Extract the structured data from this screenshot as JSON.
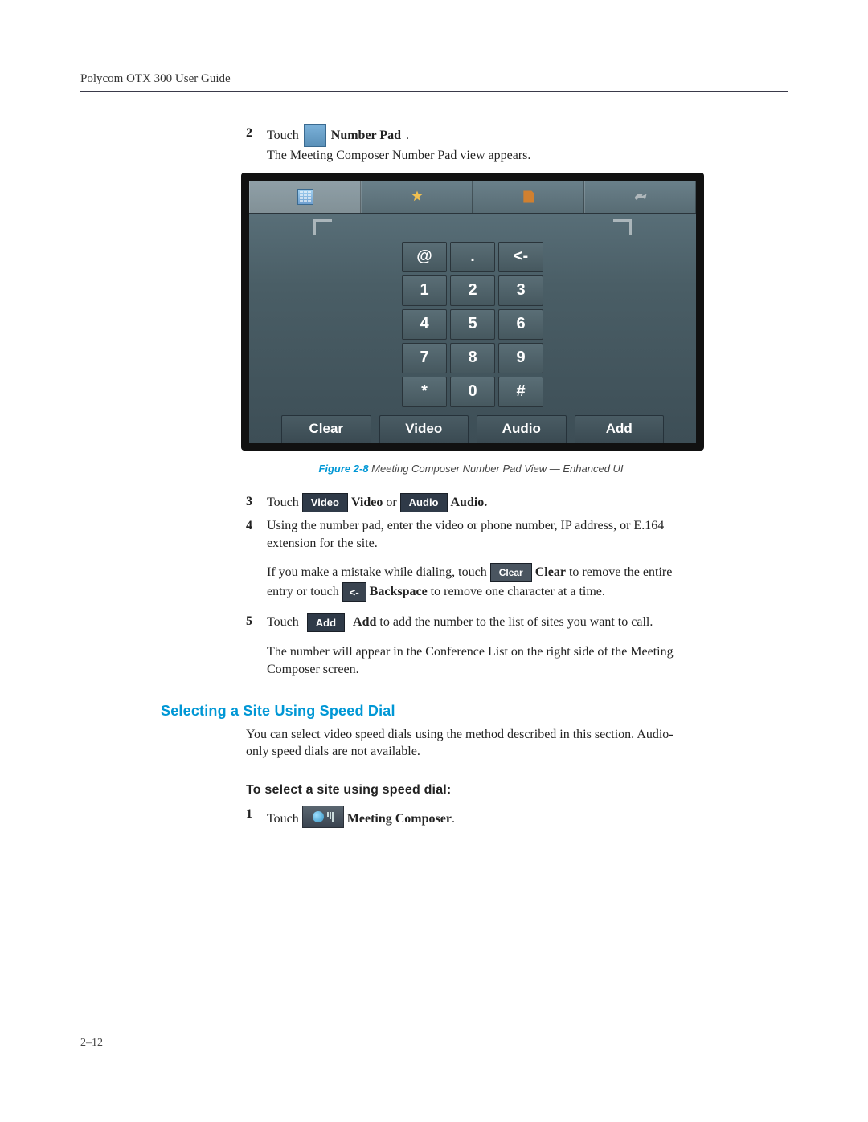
{
  "header": {
    "running_head": "Polycom OTX 300 User Guide"
  },
  "steps": {
    "s2": {
      "num": "2",
      "touch": "Touch",
      "label": "Number Pad",
      "period": ".",
      "line2": "The Meeting Composer Number Pad view appears."
    },
    "s3": {
      "num": "3",
      "touch": "Touch",
      "video_btn": "Video",
      "video_bold": "Video",
      "or": " or ",
      "audio_btn": "Audio",
      "audio_bold": "Audio."
    },
    "s4": {
      "num": "4",
      "text1": "Using the number pad, enter the video or phone number, IP address, or E.164 extension for the site.",
      "text2a": "If you make a mistake while dialing, touch ",
      "clear_btn": "Clear",
      "text2b": " Clear",
      "text2c": " to remove the entire entry or touch ",
      "back_btn": "<-",
      "text2d": " Backspace",
      "text2e": " to remove one character at a time."
    },
    "s5": {
      "num": "5",
      "touch": "Touch",
      "add_btn": "Add",
      "add_bold": "Add",
      "rest": " to add the number to the list of sites you want to call.",
      "text2": "The number will appear in the Conference List on the right side of the Meeting Composer screen."
    },
    "sd1": {
      "num": "1",
      "touch": "Touch",
      "label": "Meeting Composer",
      "period": "."
    }
  },
  "screenshot": {
    "keypad": [
      "@",
      ".",
      "<-",
      "1",
      "2",
      "3",
      "4",
      "5",
      "6",
      "7",
      "8",
      "9",
      "*",
      "0",
      "#"
    ],
    "buttons": [
      "Clear",
      "Video",
      "Audio",
      "Add"
    ]
  },
  "caption": {
    "fig": "Figure 2-8",
    "text": "  Meeting Composer Number Pad View — Enhanced UI"
  },
  "section": {
    "speed_dial_heading": "Selecting a Site Using Speed Dial",
    "speed_dial_body": "You can select video speed dials using the method described in this section. Audio-only speed dials are not available.",
    "task_heading": "To select a site using speed dial:"
  },
  "footer": {
    "pagenum": "2–12"
  }
}
